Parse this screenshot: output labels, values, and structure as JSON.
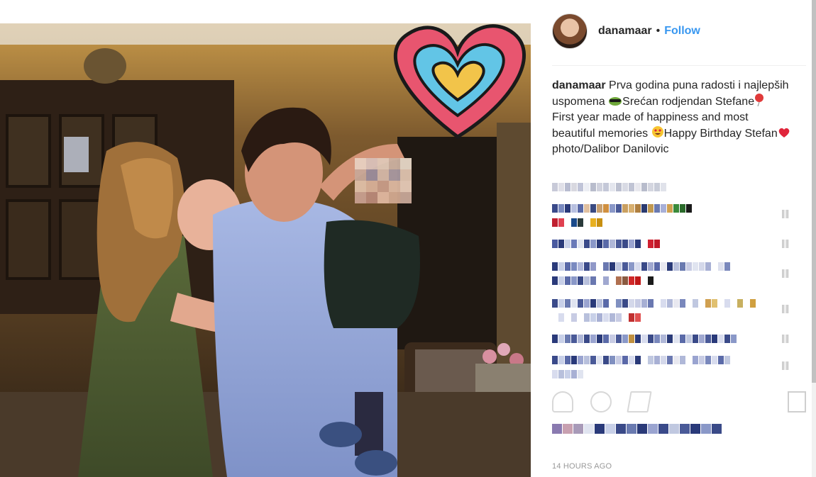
{
  "post": {
    "username": "danamaar",
    "separator": "•",
    "follow_label": "Follow",
    "caption_user": "danamaar",
    "caption_line1": "Prva godina puna radosti i najlepših uspomena",
    "caption_line2": "Srećan rodjendan Stefane",
    "caption_line3": "First year made of happiness and most beautiful memories ",
    "caption_line4": "Happy Birthday Stefan",
    "caption_line5": " photo/Dalibor Danilovic",
    "timestamp": "14 HOURS AGO"
  },
  "icons": {
    "avatar": "profile-avatar",
    "like": "heart-outline-icon",
    "comment": "comment-bubble-icon",
    "share": "share-icon",
    "save": "bookmark-icon",
    "caption_emoji_1": "sunglasses-emoji",
    "caption_emoji_2": "balloon-emoji",
    "caption_emoji_3": "heart-eyes-emoji",
    "caption_emoji_4": "red-heart-emoji"
  },
  "colors": {
    "accent": "#3897f0",
    "text": "#262626",
    "muted": "#999999",
    "divider": "#efefef"
  }
}
